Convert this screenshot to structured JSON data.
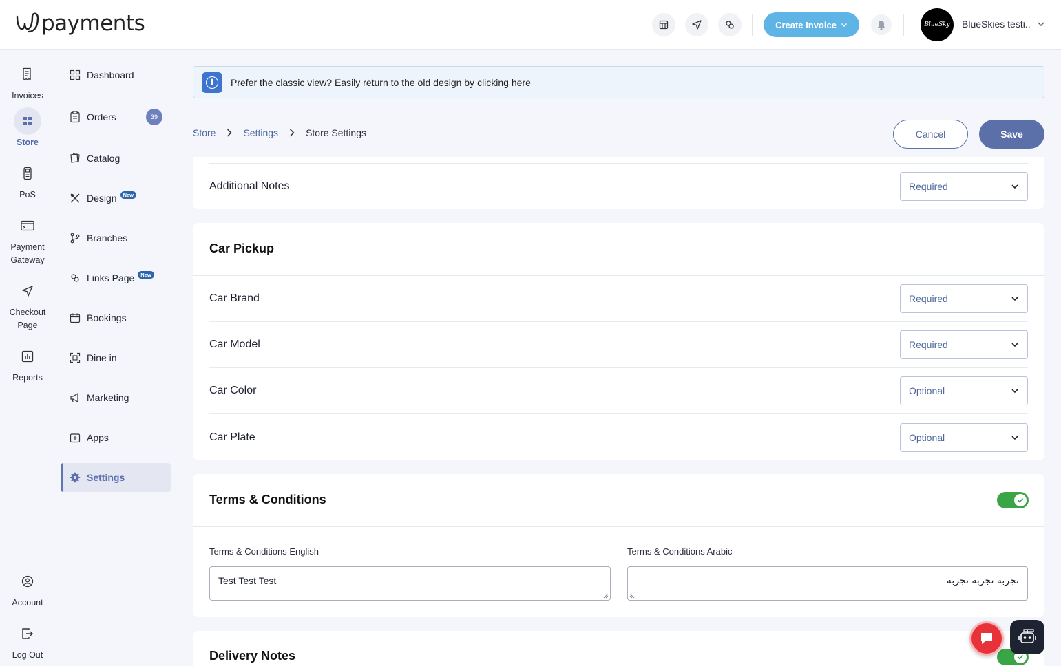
{
  "brand": {
    "name": "payments"
  },
  "header": {
    "create_invoice_label": "Create Invoice",
    "user_name": "BlueSkies testi...",
    "avatar_text": "BlueSky"
  },
  "rail": [
    {
      "label": "Invoices",
      "icon": "invoice-icon"
    },
    {
      "label": "Store",
      "icon": "store-icon",
      "active": true
    },
    {
      "label": "PoS",
      "icon": "pos-icon"
    },
    {
      "label": "Payment Gateway",
      "icon": "gateway-icon"
    },
    {
      "label": "Checkout Page",
      "icon": "send-icon"
    },
    {
      "label": "Reports",
      "icon": "reports-icon"
    },
    {
      "label": "Account",
      "icon": "account-icon"
    },
    {
      "label": "Log Out",
      "icon": "logout-icon"
    }
  ],
  "menu": {
    "dashboard": "Dashboard",
    "orders": "Orders",
    "orders_count": "39",
    "catalog": "Catalog",
    "design": "Design",
    "new_tag": "New",
    "branches": "Branches",
    "links_page": "Links Page",
    "bookings": "Bookings",
    "dine_in": "Dine in",
    "marketing": "Marketing",
    "apps": "Apps",
    "settings": "Settings"
  },
  "banner": {
    "text": "Prefer the classic view? Easily return to the old design by",
    "link": "clicking here"
  },
  "breadcrumb": {
    "store": "Store",
    "settings": "Settings",
    "current": "Store Settings"
  },
  "actions": {
    "cancel": "Cancel",
    "save": "Save"
  },
  "additional_notes": {
    "label": "Additional Notes",
    "value": "Required"
  },
  "car_pickup": {
    "title": "Car Pickup",
    "fields": [
      {
        "label": "Car Brand",
        "value": "Required"
      },
      {
        "label": "Car Model",
        "value": "Required"
      },
      {
        "label": "Car Color",
        "value": "Optional"
      },
      {
        "label": "Car Plate",
        "value": "Optional"
      }
    ]
  },
  "terms": {
    "title": "Terms & Conditions",
    "enabled": true,
    "english_label": "Terms & Conditions English",
    "english_value": "Test Test Test",
    "arabic_label": "Terms & Conditions Arabic",
    "arabic_value": "تجربة تجربة تجربة"
  },
  "delivery_notes": {
    "title": "Delivery Notes",
    "enabled": true
  },
  "colors": {
    "accent": "#5b6fa8",
    "toggle_on": "#3aa546",
    "create_btn": "#5fb4e6"
  }
}
